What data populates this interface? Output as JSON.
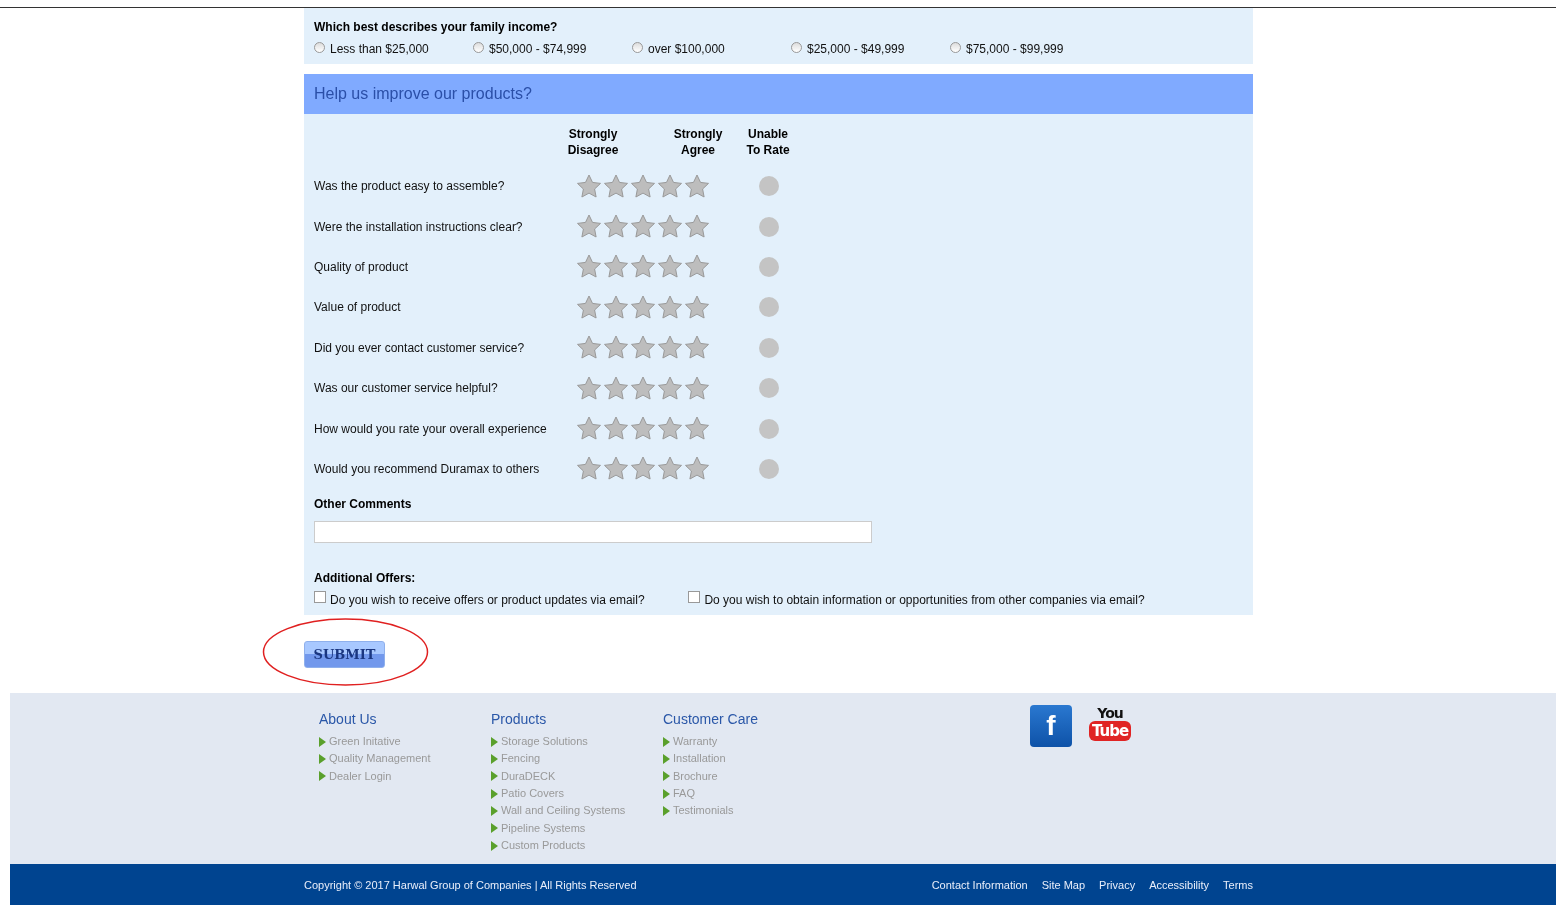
{
  "income": {
    "question": "Which best describes your family income?",
    "options": [
      {
        "label": "Less than $25,000",
        "selected": false
      },
      {
        "label": "$50,000 - $74,999",
        "selected": false
      },
      {
        "label": "over $100,000",
        "selected": false
      },
      {
        "label": "$25,000 - $49,999",
        "selected": false
      },
      {
        "label": "$75,000 - $99,999",
        "selected": false
      }
    ]
  },
  "survey": {
    "title": "Help us improve our products?",
    "headers": [
      {
        "top": "Strongly",
        "bottom": "Disagree"
      },
      {
        "top": "Strongly",
        "bottom": "Agree"
      },
      {
        "top": "Unable",
        "bottom": "To Rate"
      }
    ],
    "questions": [
      {
        "text": "Was the product easy to assemble?",
        "stars": 0,
        "unable_selected": false
      },
      {
        "text": "Were the installation instructions clear?",
        "stars": 0,
        "unable_selected": false
      },
      {
        "text": "Quality of product",
        "stars": 0,
        "unable_selected": false
      },
      {
        "text": "Value of product",
        "stars": 0,
        "unable_selected": false
      },
      {
        "text": "Did you ever contact customer service?",
        "stars": 0,
        "unable_selected": false
      },
      {
        "text": "Was our customer service helpful?",
        "stars": 0,
        "unable_selected": false
      },
      {
        "text": "How would you rate your overall experience",
        "stars": 0,
        "unable_selected": false
      },
      {
        "text": "Would you recommend Duramax to others",
        "stars": 0,
        "unable_selected": false
      }
    ],
    "comments_label": "Other Comments",
    "offers_label": "Additional Offers:",
    "offers": [
      {
        "label": "Do you wish to receive offers or product updates via email?",
        "checked": false
      },
      {
        "label": "Do you wish to obtain information or opportunities from other companies via email?",
        "checked": false
      }
    ]
  },
  "submit": "SUBMIT",
  "footer": {
    "columns": [
      {
        "title": "About Us",
        "links": [
          "Green Initative",
          "Quality Management",
          "Dealer Login"
        ]
      },
      {
        "title": "Products",
        "links": [
          "Storage Solutions",
          "Fencing",
          "DuraDECK",
          "Patio Covers",
          "Wall and Ceiling Systems",
          "Pipeline Systems",
          "Custom Products"
        ]
      },
      {
        "title": "Customer Care",
        "links": [
          "Warranty",
          "Installation",
          "Brochure",
          "FAQ",
          "Testimonials"
        ]
      }
    ],
    "social": [
      {
        "kind": "facebook",
        "glyph": "f"
      },
      {
        "kind": "youtube",
        "top": "You",
        "bottom": "Tube"
      }
    ],
    "copyright": "Copyright © 2017 Harwal Group of Companies | All Rights Reserved",
    "bottom_links": [
      "Contact Information",
      "Site Map",
      "Privacy",
      "Accessibility",
      "Terms"
    ]
  }
}
